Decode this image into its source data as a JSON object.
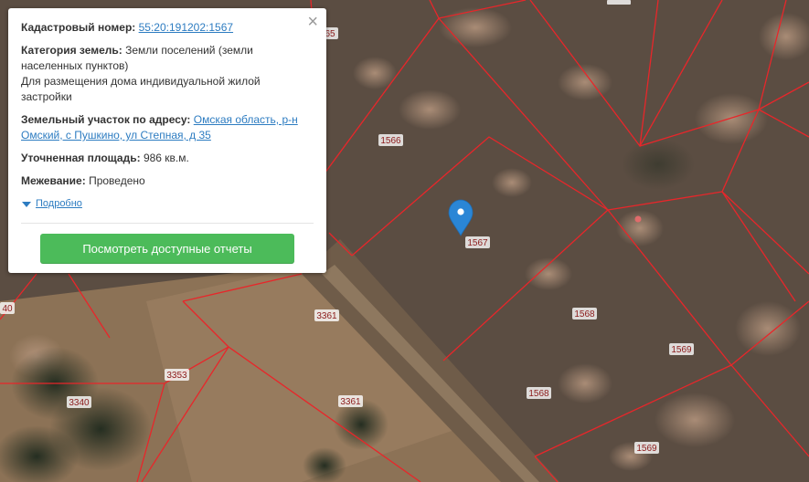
{
  "popup": {
    "close_label": "×",
    "cadastral_label": "Кадастровый номер:",
    "cadastral_number": "55:20:191202:1567",
    "category_label": "Категория земель:",
    "category_value": "Земли поселений (земли населенных пунктов)",
    "usage": "Для размещения дома индивидуальной жилой застройки",
    "address_label": "Земельный участок по адресу:",
    "address_value": "Омская область, р-н Омский, с Пушкино, ул Степная, д 35",
    "area_label": "Уточненная площадь:",
    "area_value": "986 кв.м.",
    "survey_label": "Межевание:",
    "survey_value": "Проведено",
    "more_label": "Подробно",
    "button_label": "Посмотреть доступные отчеты"
  },
  "map": {
    "parcel_labels": [
      "1566",
      "1567",
      "1568",
      "1568",
      "1569",
      "1569",
      "3361",
      "3361",
      "3353",
      "3340",
      "40",
      "65"
    ],
    "boundary_color": "#e8262a",
    "marker_color": "#2a86d6",
    "icons": {
      "marker": "map-pin-icon",
      "close": "close-icon",
      "more": "triangle-down-icon"
    }
  }
}
